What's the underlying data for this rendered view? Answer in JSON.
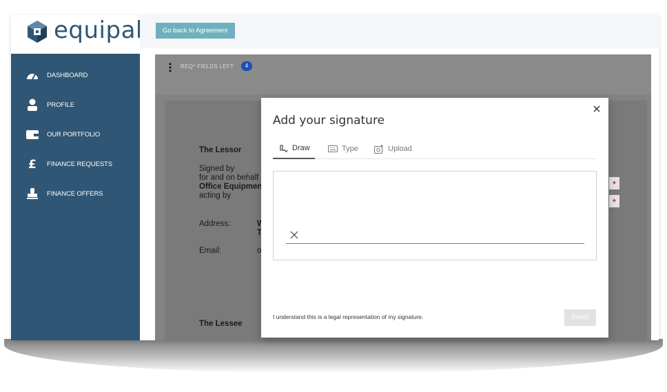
{
  "brand": {
    "name": "equipal",
    "color": "#2f5674"
  },
  "sidebar": {
    "items": [
      {
        "label": "DASHBOARD",
        "icon": "gauge-icon"
      },
      {
        "label": "PROFILE",
        "icon": "person-icon"
      },
      {
        "label": "OUR PORTFOLIO",
        "icon": "wallet-icon"
      },
      {
        "label": "FINANCE REQUESTS",
        "icon": "pound-icon"
      },
      {
        "label": "FINANCE OFFERS",
        "icon": "stamp-icon"
      }
    ]
  },
  "topbar": {
    "back_label": "Go back to Agreement"
  },
  "doc_toolbar": {
    "req_label": "REQ* FIELDS LEFT",
    "req_count": "4"
  },
  "document": {
    "lessor_heading": "The Lessor",
    "signed_by": "Signed by",
    "for_and_on_behalf": "for and on behalf",
    "office_equipment": "Office Equipmen",
    "acting_by": "acting by",
    "address_label": "Address:",
    "address_value_1": "W",
    "address_value_2": "T",
    "email_label": "Email:",
    "email_value": "o",
    "lessee_heading": "The Lessee",
    "asterisk": "*"
  },
  "modal": {
    "title": "Add your signature",
    "tabs": [
      {
        "label": "Draw",
        "icon": "pen-draw-icon",
        "active": true
      },
      {
        "label": "Type",
        "icon": "keyboard-icon",
        "active": false
      },
      {
        "label": "Upload",
        "icon": "upload-image-icon",
        "active": false
      }
    ],
    "legal_text": "I understand this is a legal representation of my signature.",
    "insert_label": "Insert"
  }
}
